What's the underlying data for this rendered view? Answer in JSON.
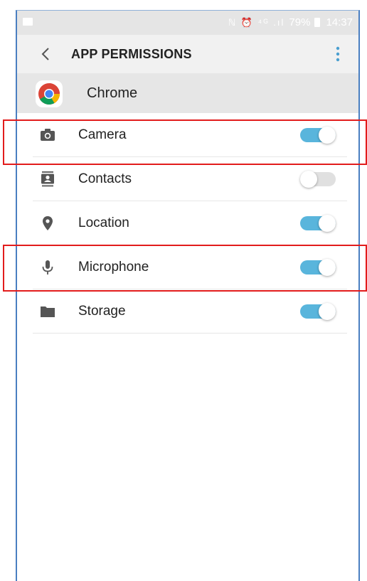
{
  "status_bar": {
    "icons": "ℕ ⏰ ⁴ᴳ .ıl",
    "battery": "79%",
    "time": "14:37"
  },
  "app_bar": {
    "title": "APP PERMISSIONS",
    "back_icon": "chevron-left-icon",
    "more_icon": "more-vert-icon"
  },
  "app": {
    "name": "Chrome",
    "icon": "chrome-logo"
  },
  "permissions": [
    {
      "label": "Camera",
      "icon": "camera-icon",
      "enabled": true
    },
    {
      "label": "Contacts",
      "icon": "contacts-icon",
      "enabled": false
    },
    {
      "label": "Location",
      "icon": "location-pin-icon",
      "enabled": true
    },
    {
      "label": "Microphone",
      "icon": "microphone-icon",
      "enabled": true
    },
    {
      "label": "Storage",
      "icon": "folder-icon",
      "enabled": true
    }
  ],
  "colors": {
    "toggle_on": "#59b5dc",
    "toggle_off": "#e0e0e0",
    "highlight": "#e21c1c"
  }
}
